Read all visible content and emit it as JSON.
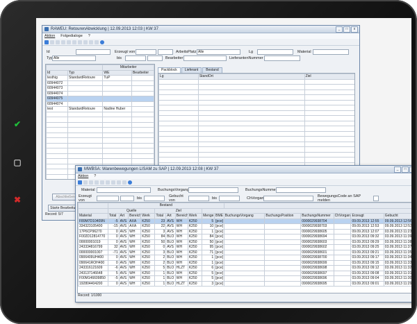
{
  "side_buttons": [
    {
      "icon": "check-icon",
      "glyph": "✔",
      "color": "#1fbf3a"
    },
    {
      "icon": "square-icon",
      "glyph": "▢",
      "color": "#bbbbbb"
    },
    {
      "icon": "close-icon",
      "glyph": "✖",
      "color": "#d32a2a"
    }
  ],
  "window1": {
    "title": "RAWEU: RetourenAbwicklung | 12.09.2013 12:03 | KW 37",
    "menu": [
      "Aktion",
      "Folgedialoge",
      "?"
    ],
    "fields": {
      "id_label": "Id",
      "erzeugt_von_label": "Erzeugt von",
      "bis_label": "bis",
      "arbeitsplatz_label": "ArbeitsPlatz",
      "arbeitsplatz_value": "Alle",
      "lg_label": "Lg",
      "material_label": "Material",
      "typ_label": "Typ",
      "typ_value": "Alle",
      "bearbeiter_label": "Bearbeiter",
      "lieferanten_label": "LieferantenNummer"
    },
    "left_table": {
      "group_header": "Mitarbeiter",
      "headers": [
        "Id",
        "Typ",
        "WE",
        "Bearbeiter"
      ],
      "rows": [
        [
          "testhig",
          "StandardRetoure",
          "TuP",
          ""
        ],
        [
          "60944072",
          "",
          "",
          ""
        ],
        [
          "60944073",
          "",
          "",
          ""
        ],
        [
          "60944074",
          "",
          "",
          ""
        ],
        [
          "60944075",
          "",
          "",
          ""
        ],
        [
          "60944074",
          "",
          "",
          ""
        ],
        [
          "test",
          "StandardRetoure",
          "Nadine Huber",
          ""
        ]
      ],
      "selected_row": 4
    },
    "tabs": [
      "Packblock",
      "Lieferant",
      "Bestand"
    ],
    "right_headers": [
      "Lg",
      "StandOrt",
      "Ziel"
    ],
    "buttons": {
      "abschliessen": "Abschließen",
      "starte": "Starte Bearbeitung"
    },
    "record": "Record: 5/7"
  },
  "window2": {
    "title": "MWBSA: Warenbewegungen LISAM zu SAP | 12.09.2013 12:08 | KW 37",
    "menu": [
      "Aktion",
      "?"
    ],
    "fields": {
      "material_label": "Material",
      "buchungsvorgang_label": "BuchungsVorgang",
      "buchungsnummer_label": "BuchungsNummer",
      "erzeugt_von_label": "Erzeugt von",
      "bis_label": "bis",
      "gebucht_von_label": "Gebucht von",
      "ch_vorgang_label": "ChVorgang",
      "bewegungscode_label": "BewegungsCode an SAP melden"
    },
    "group_headers": {
      "bestand": "Bestand",
      "quelle": "Quelle",
      "ziel": "Ziel"
    },
    "headers": [
      "Material",
      "Total",
      "Art",
      "Bereich",
      "Werk",
      "Total",
      "Art",
      "Bereich",
      "Werk",
      "Menge",
      "BME",
      "BuchungsVorgang",
      "BuchungsPosition",
      "BuchungsNummer",
      "ChVorgang",
      "Erzeugt",
      "Gebucht"
    ],
    "rows": [
      [
        "F89M7D10409N",
        "-5",
        "AVS",
        "AXA",
        "K250",
        "23",
        "AVS",
        "WH",
        "K250",
        "5",
        "[pce]",
        "",
        "",
        "0900029938704",
        "",
        "09.09.2013 12:55",
        "09.09.2013 12:56"
      ],
      [
        "334323105400",
        "-15",
        "AVS",
        "AXA",
        "K250",
        "22",
        "AVS",
        "WH",
        "K250",
        "10",
        "[pce]",
        "",
        "",
        "0900029938703",
        "",
        "09.09.2013 12:53",
        "09.09.2013 12:53"
      ],
      [
        "17P6CP96270",
        "0",
        "AVS",
        "WH",
        "K250",
        "3",
        "AVS",
        "WH",
        "K250",
        "1",
        "[pce]",
        "",
        "",
        "0900029938605",
        "",
        "09.09.2013 12:07",
        "03.09.2013 11:23"
      ],
      [
        "F002D12814770",
        "0",
        "AVS",
        "WH",
        "K250",
        "84",
        "BLO",
        "WH",
        "K250",
        "84",
        "[pce]",
        "",
        "",
        "0900029938694",
        "",
        "03.09.2013 09:32",
        "03.09.2013 11:39"
      ],
      [
        "00000001019",
        "0",
        "AVS",
        "WH",
        "K250",
        "50",
        "BLO",
        "WH",
        "K250",
        "50",
        "[pce]",
        "",
        "",
        "0900029938603",
        "",
        "03.09.2013 09:29",
        "03.09.2013 11:38"
      ],
      [
        "243334816799",
        "32",
        "AVS",
        "WH",
        "K250",
        "0",
        "AVS",
        "WH",
        "K250",
        "95",
        "[pce]",
        "",
        "",
        "0900029938602",
        "",
        "03.09.2013 09:25",
        "03.09.2013 11:37"
      ],
      [
        "000000001007",
        "-71",
        "AVS",
        "WH",
        "K250",
        "3",
        "BLO",
        "WH",
        "K250",
        "71",
        "[pce]",
        "",
        "",
        "0900029938601",
        "",
        "03.09.2013 09:21",
        "03.09.2013 11:35"
      ],
      [
        "0906409UH400",
        "0",
        "AVS",
        "WH",
        "K250",
        "2",
        "BLO",
        "WH",
        "K250",
        "1",
        "[pce]",
        "",
        "",
        "0900029938700",
        "",
        "03.09.2013 09:17",
        "03.09.2013 11:34"
      ],
      [
        "090641ROH400",
        "0",
        "AVS",
        "WH",
        "K250",
        "2",
        "BLO",
        "WH",
        "K250",
        "1",
        "[pce]",
        "",
        "",
        "0900029938699",
        "",
        "03.09.2013 09:15",
        "03.09.2013 11:33"
      ],
      [
        "243316121609",
        "-6",
        "AVS",
        "WH",
        "K250",
        "5",
        "BLO",
        "HLZT",
        "K250",
        "6",
        "[pce]",
        "",
        "",
        "0900029938698",
        "",
        "03.09.2013 09:12",
        "03.09.2013 11:32"
      ],
      [
        "243137146648",
        "5",
        "AVS",
        "WH",
        "K250",
        "1",
        "BLO",
        "WH",
        "K250",
        "5",
        "[pce]",
        "",
        "",
        "0900029938697",
        "",
        "03.09.2013 09:08",
        "03.09.2013 11:31"
      ],
      [
        "F00M146609850",
        "-5",
        "AVS",
        "WH",
        "K250",
        "1",
        "BLO",
        "WH",
        "K250",
        "5",
        "[pce]",
        "",
        "",
        "0900029938696",
        "",
        "03.09.2013 09:04",
        "03.09.2013 11:30"
      ],
      [
        "192804404200",
        "0",
        "AVS",
        "WH",
        "K250",
        "1",
        "BLO",
        "HLZT",
        "K250",
        "3",
        "[pce]",
        "",
        "",
        "0900029938695",
        "",
        "03.09.2013 09:01",
        "03.09.2013 11:29"
      ]
    ],
    "selected_row": 0,
    "record": "Record: 1/1000"
  }
}
